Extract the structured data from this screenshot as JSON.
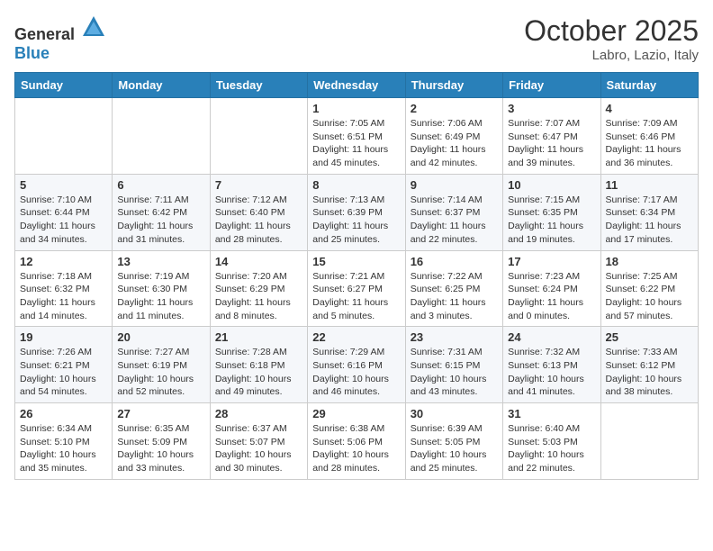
{
  "header": {
    "logo_general": "General",
    "logo_blue": "Blue",
    "month_title": "October 2025",
    "location": "Labro, Lazio, Italy"
  },
  "weekdays": [
    "Sunday",
    "Monday",
    "Tuesday",
    "Wednesday",
    "Thursday",
    "Friday",
    "Saturday"
  ],
  "weeks": [
    [
      {
        "day": "",
        "info": ""
      },
      {
        "day": "",
        "info": ""
      },
      {
        "day": "",
        "info": ""
      },
      {
        "day": "1",
        "info": "Sunrise: 7:05 AM\nSunset: 6:51 PM\nDaylight: 11 hours and 45 minutes."
      },
      {
        "day": "2",
        "info": "Sunrise: 7:06 AM\nSunset: 6:49 PM\nDaylight: 11 hours and 42 minutes."
      },
      {
        "day": "3",
        "info": "Sunrise: 7:07 AM\nSunset: 6:47 PM\nDaylight: 11 hours and 39 minutes."
      },
      {
        "day": "4",
        "info": "Sunrise: 7:09 AM\nSunset: 6:46 PM\nDaylight: 11 hours and 36 minutes."
      }
    ],
    [
      {
        "day": "5",
        "info": "Sunrise: 7:10 AM\nSunset: 6:44 PM\nDaylight: 11 hours and 34 minutes."
      },
      {
        "day": "6",
        "info": "Sunrise: 7:11 AM\nSunset: 6:42 PM\nDaylight: 11 hours and 31 minutes."
      },
      {
        "day": "7",
        "info": "Sunrise: 7:12 AM\nSunset: 6:40 PM\nDaylight: 11 hours and 28 minutes."
      },
      {
        "day": "8",
        "info": "Sunrise: 7:13 AM\nSunset: 6:39 PM\nDaylight: 11 hours and 25 minutes."
      },
      {
        "day": "9",
        "info": "Sunrise: 7:14 AM\nSunset: 6:37 PM\nDaylight: 11 hours and 22 minutes."
      },
      {
        "day": "10",
        "info": "Sunrise: 7:15 AM\nSunset: 6:35 PM\nDaylight: 11 hours and 19 minutes."
      },
      {
        "day": "11",
        "info": "Sunrise: 7:17 AM\nSunset: 6:34 PM\nDaylight: 11 hours and 17 minutes."
      }
    ],
    [
      {
        "day": "12",
        "info": "Sunrise: 7:18 AM\nSunset: 6:32 PM\nDaylight: 11 hours and 14 minutes."
      },
      {
        "day": "13",
        "info": "Sunrise: 7:19 AM\nSunset: 6:30 PM\nDaylight: 11 hours and 11 minutes."
      },
      {
        "day": "14",
        "info": "Sunrise: 7:20 AM\nSunset: 6:29 PM\nDaylight: 11 hours and 8 minutes."
      },
      {
        "day": "15",
        "info": "Sunrise: 7:21 AM\nSunset: 6:27 PM\nDaylight: 11 hours and 5 minutes."
      },
      {
        "day": "16",
        "info": "Sunrise: 7:22 AM\nSunset: 6:25 PM\nDaylight: 11 hours and 3 minutes."
      },
      {
        "day": "17",
        "info": "Sunrise: 7:23 AM\nSunset: 6:24 PM\nDaylight: 11 hours and 0 minutes."
      },
      {
        "day": "18",
        "info": "Sunrise: 7:25 AM\nSunset: 6:22 PM\nDaylight: 10 hours and 57 minutes."
      }
    ],
    [
      {
        "day": "19",
        "info": "Sunrise: 7:26 AM\nSunset: 6:21 PM\nDaylight: 10 hours and 54 minutes."
      },
      {
        "day": "20",
        "info": "Sunrise: 7:27 AM\nSunset: 6:19 PM\nDaylight: 10 hours and 52 minutes."
      },
      {
        "day": "21",
        "info": "Sunrise: 7:28 AM\nSunset: 6:18 PM\nDaylight: 10 hours and 49 minutes."
      },
      {
        "day": "22",
        "info": "Sunrise: 7:29 AM\nSunset: 6:16 PM\nDaylight: 10 hours and 46 minutes."
      },
      {
        "day": "23",
        "info": "Sunrise: 7:31 AM\nSunset: 6:15 PM\nDaylight: 10 hours and 43 minutes."
      },
      {
        "day": "24",
        "info": "Sunrise: 7:32 AM\nSunset: 6:13 PM\nDaylight: 10 hours and 41 minutes."
      },
      {
        "day": "25",
        "info": "Sunrise: 7:33 AM\nSunset: 6:12 PM\nDaylight: 10 hours and 38 minutes."
      }
    ],
    [
      {
        "day": "26",
        "info": "Sunrise: 6:34 AM\nSunset: 5:10 PM\nDaylight: 10 hours and 35 minutes."
      },
      {
        "day": "27",
        "info": "Sunrise: 6:35 AM\nSunset: 5:09 PM\nDaylight: 10 hours and 33 minutes."
      },
      {
        "day": "28",
        "info": "Sunrise: 6:37 AM\nSunset: 5:07 PM\nDaylight: 10 hours and 30 minutes."
      },
      {
        "day": "29",
        "info": "Sunrise: 6:38 AM\nSunset: 5:06 PM\nDaylight: 10 hours and 28 minutes."
      },
      {
        "day": "30",
        "info": "Sunrise: 6:39 AM\nSunset: 5:05 PM\nDaylight: 10 hours and 25 minutes."
      },
      {
        "day": "31",
        "info": "Sunrise: 6:40 AM\nSunset: 5:03 PM\nDaylight: 10 hours and 22 minutes."
      },
      {
        "day": "",
        "info": ""
      }
    ]
  ]
}
